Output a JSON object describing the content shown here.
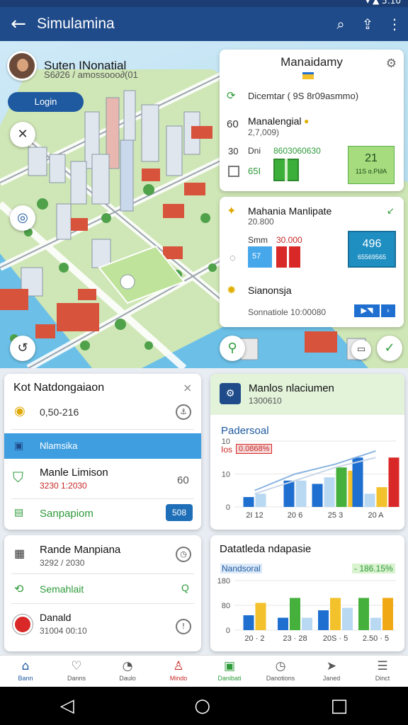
{
  "status_bar": {
    "icons": "▾ ▲ 5:10"
  },
  "app_bar": {
    "title": "Simulamina",
    "back_icon": "arrow-left-icon",
    "actions": [
      "search-icon",
      "share-icon",
      "more-vertical-icon"
    ]
  },
  "profile": {
    "name": "Suten INonatial",
    "subtitle": "S6∂26 / amossooo∂(01",
    "login_label": "Login"
  },
  "map_overlay_dots": "●●●●",
  "info_card": {
    "title": "Manaidamy",
    "line1": "Dicemtar ( 9S 8r09asmmo)",
    "row_a_num": "60",
    "row_a_label": "Manalengial",
    "row_a_sub": "2,7,009)",
    "row_b_num": "30",
    "row_b_label": "Dni",
    "row_b_value": "8603060630",
    "row_c_value": "65I",
    "badge_big": "21",
    "badge_small": "11S ɑ.PI∂A"
  },
  "info_card2": {
    "title": "Mahania Manlipate",
    "sub": "20.800",
    "row_label": "Smm",
    "row_value": "30.000",
    "blue_chip": "57",
    "badge_big": "496",
    "badge_small": "65569565",
    "row2_label": "Sianonsja",
    "row2_sub": "Sonnatiole 10:00080"
  },
  "panel_left_top": {
    "title": "Kot Natdongaiaon",
    "item1": "0,50-216",
    "selected": "Nlamsika",
    "item2_title": "Manle Limison",
    "item2_sub": "3230 1:2030",
    "item2_tag": "60",
    "item3": "Sanpapiom",
    "item3_badge": "508"
  },
  "panel_right_top": {
    "title": "Manlos nlaciumen",
    "sub": "1300610",
    "chart_title": "Padersoal",
    "chart_tag": "Ios",
    "chart_tag_value": "0.0868%"
  },
  "panel_left_bottom": {
    "item1_title": "Rande Manpiana",
    "item1_sub": "3292 / 2030",
    "item2_title": "Semahlait",
    "item3_title": "Danald",
    "item3_sub": "31004 00:10"
  },
  "panel_right_bottom": {
    "title": "Datatleda ndapasie",
    "chart_title": "Nandsoral",
    "chart_tag": "- 186.15%"
  },
  "bottom_nav": [
    {
      "label": "Bann",
      "icon": "home-icon"
    },
    {
      "label": "Danns",
      "icon": "heart-icon"
    },
    {
      "label": "Daulo",
      "icon": "alert-icon"
    },
    {
      "label": "Mindo",
      "icon": "person-icon"
    },
    {
      "label": "Danibati",
      "icon": "document-icon"
    },
    {
      "label": "Danotions",
      "icon": "clock-icon"
    },
    {
      "label": "Janed",
      "icon": "navigate-icon"
    },
    {
      "label": "Dinct",
      "icon": "menu-icon"
    }
  ],
  "chart_data": [
    {
      "type": "bar",
      "title": "Padersoal",
      "categories": [
        "21",
        "20",
        "25",
        "20"
      ],
      "x_tick_labels": [
        "2I 12",
        "20 6",
        "25 3",
        "20 A"
      ],
      "ylim": [
        0,
        20
      ],
      "y_ticks": [
        0,
        10,
        20
      ],
      "y_tick_labels": [
        "0",
        "10",
        "10"
      ],
      "series": [
        {
          "color": "#1f6fd0",
          "values": [
            3,
            8,
            7,
            15
          ]
        },
        {
          "color": "#b9d8f2",
          "values": [
            4,
            8,
            9,
            4
          ]
        },
        {
          "color": "#45b13c",
          "values": [
            0,
            0,
            12,
            0
          ]
        },
        {
          "color": "#f2c12b",
          "values": [
            0,
            0,
            11,
            6
          ]
        },
        {
          "color": "#d92828",
          "values": [
            0,
            0,
            0,
            15
          ]
        }
      ],
      "trend_lines": [
        {
          "color": "#8ab4e0",
          "values": [
            5,
            10,
            13,
            17
          ]
        },
        {
          "color": "#c9d6e8",
          "values": [
            4,
            8,
            12,
            15
          ]
        }
      ]
    },
    {
      "type": "bar",
      "title": "Nandsoral",
      "categories": [
        "20",
        "23",
        "20",
        "2"
      ],
      "x_tick_labels": [
        "20 · 2",
        "23 · 28",
        "20S · 5",
        "2.50 · 5"
      ],
      "ylim": [
        0,
        20
      ],
      "y_ticks": [
        0,
        10,
        20
      ],
      "y_tick_labels": [
        "0",
        "80",
        "180"
      ],
      "series": [
        {
          "color": "#1f6fd0",
          "values": [
            6,
            5,
            8,
            0
          ]
        },
        {
          "color": "#f2c12b",
          "values": [
            11,
            0,
            13,
            0
          ]
        },
        {
          "color": "#45b13c",
          "values": [
            0,
            13,
            0,
            13
          ]
        },
        {
          "color": "#b9d8f2",
          "values": [
            0,
            5,
            9,
            5
          ]
        },
        {
          "color": "#f0a915",
          "values": [
            0,
            0,
            0,
            13
          ]
        }
      ]
    }
  ]
}
